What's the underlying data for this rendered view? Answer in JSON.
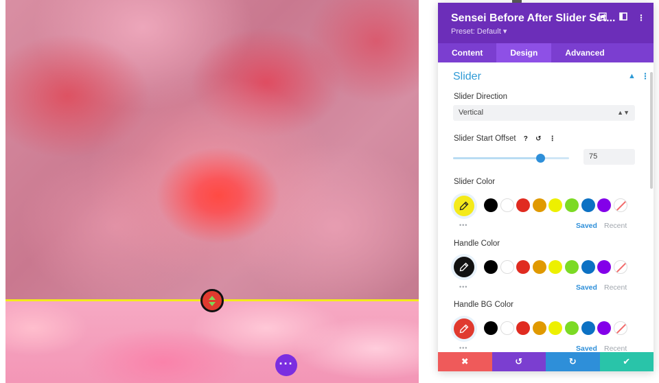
{
  "panel": {
    "title": "Sensei Before After Slider Set...",
    "preset": "Preset: Default ▾",
    "tabs": [
      {
        "label": "Content",
        "active": false
      },
      {
        "label": "Design",
        "active": true
      },
      {
        "label": "Advanced",
        "active": false
      }
    ],
    "section_title": "Slider",
    "slider_direction": {
      "label": "Slider Direction",
      "value": "Vertical"
    },
    "slider_start_offset": {
      "label": "Slider Start Offset",
      "value": "75",
      "fraction": 0.75
    },
    "colors": {
      "slider_color": {
        "label": "Slider Color",
        "current": "#f4ea1b"
      },
      "handle_color": {
        "label": "Handle Color",
        "current": "#111111"
      },
      "handle_bg_color": {
        "label": "Handle BG Color",
        "current": "#e03a2f"
      }
    },
    "palette": [
      "#000000",
      "#ffffff",
      "#e02b20",
      "#e09900",
      "#edf000",
      "#7cda24",
      "#0c71c3",
      "#8300e9",
      "none"
    ],
    "saved_label": "Saved",
    "recent_label": "Recent",
    "footer_colors": [
      "#ef5a5a",
      "#7b3ed0",
      "#2e8fd9",
      "#29c4a9"
    ]
  },
  "preview": {
    "divider_color": "#f4ea1b",
    "handle_bg": "#e03a2f",
    "handle_arrow_color": "#7ed957"
  }
}
